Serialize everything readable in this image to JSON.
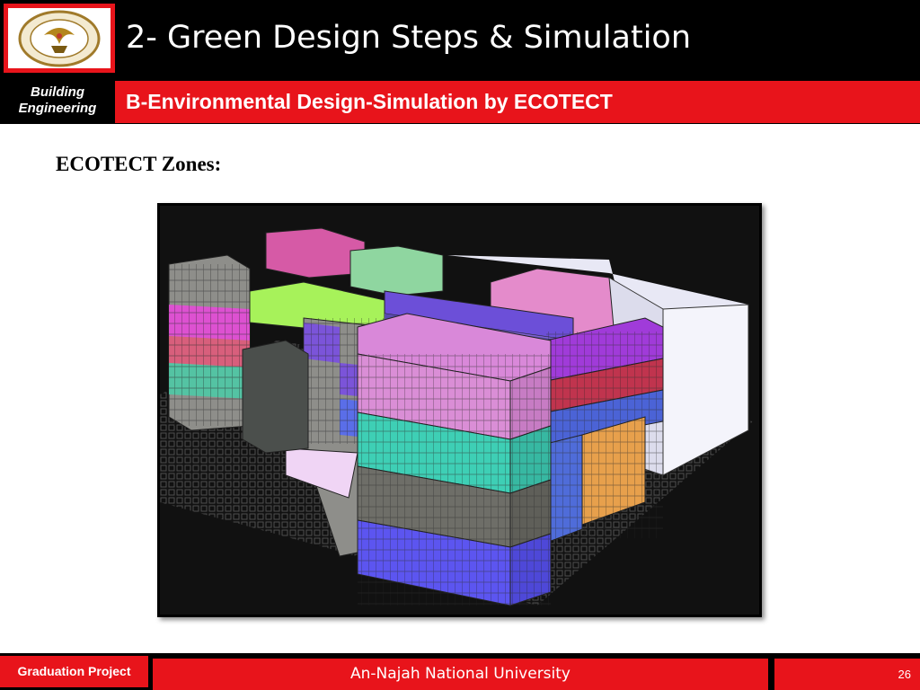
{
  "header": {
    "title": "2- Green Design Steps & Simulation",
    "logo": "university-seal"
  },
  "section": {
    "department": "Building Engineering",
    "subtitle": "B-Environmental Design-Simulation by ECOTECT"
  },
  "content": {
    "heading": "ECOTECT Zones:",
    "image": "ecotect-zones-3d-model"
  },
  "footer": {
    "left_label": "Graduation Project",
    "center_label": "An-Najah National University",
    "page_number": "26"
  },
  "colors": {
    "accent_red": "#e8141b",
    "black": "#000000"
  }
}
